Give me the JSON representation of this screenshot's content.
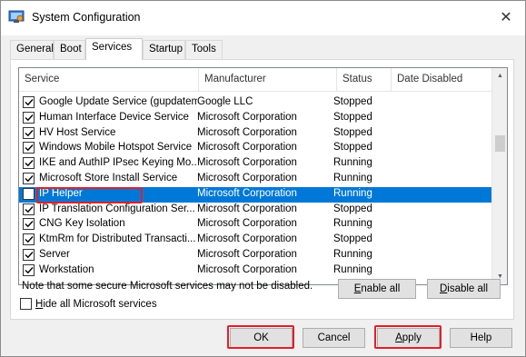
{
  "window": {
    "title": "System Configuration"
  },
  "tabs": [
    {
      "label": "General"
    },
    {
      "label": "Boot"
    },
    {
      "label": "Services"
    },
    {
      "label": "Startup"
    },
    {
      "label": "Tools"
    }
  ],
  "columns": {
    "service": "Service",
    "manufacturer": "Manufacturer",
    "status": "Status",
    "date_disabled": "Date Disabled"
  },
  "rows": [
    {
      "service": "Google Update Service (gupdatem)",
      "manufacturer": "Google LLC",
      "status": "Stopped",
      "checked": true
    },
    {
      "service": "Human Interface Device Service",
      "manufacturer": "Microsoft Corporation",
      "status": "Stopped",
      "checked": true
    },
    {
      "service": "HV Host Service",
      "manufacturer": "Microsoft Corporation",
      "status": "Stopped",
      "checked": true
    },
    {
      "service": "Windows Mobile Hotspot Service",
      "manufacturer": "Microsoft Corporation",
      "status": "Stopped",
      "checked": true
    },
    {
      "service": "IKE and AuthIP IPsec Keying Mo...",
      "manufacturer": "Microsoft Corporation",
      "status": "Running",
      "checked": true
    },
    {
      "service": "Microsoft Store Install Service",
      "manufacturer": "Microsoft Corporation",
      "status": "Running",
      "checked": true
    },
    {
      "service": "IP Helper",
      "manufacturer": "Microsoft Corporation",
      "status": "Running",
      "checked": false
    },
    {
      "service": "IP Translation Configuration Ser...",
      "manufacturer": "Microsoft Corporation",
      "status": "Stopped",
      "checked": true
    },
    {
      "service": "CNG Key Isolation",
      "manufacturer": "Microsoft Corporation",
      "status": "Running",
      "checked": true
    },
    {
      "service": "KtmRm for Distributed Transacti...",
      "manufacturer": "Microsoft Corporation",
      "status": "Stopped",
      "checked": true
    },
    {
      "service": "Server",
      "manufacturer": "Microsoft Corporation",
      "status": "Running",
      "checked": true
    },
    {
      "service": "Workstation",
      "manufacturer": "Microsoft Corporation",
      "status": "Running",
      "checked": true
    }
  ],
  "note": "Note that some secure Microsoft services may not be disabled.",
  "buttons": {
    "enable_all_u": "E",
    "enable_all_rest": "nable all",
    "disable_all_u": "D",
    "disable_all_rest": "isable all",
    "ok": "OK",
    "cancel": "Cancel",
    "apply_u": "A",
    "apply_rest": "pply",
    "help": "Help"
  },
  "hide_ms": {
    "u": "H",
    "rest": "ide all Microsoft services",
    "checked": false
  },
  "colors": {
    "selection": "#0078d7",
    "highlight_box": "#e0202a"
  }
}
